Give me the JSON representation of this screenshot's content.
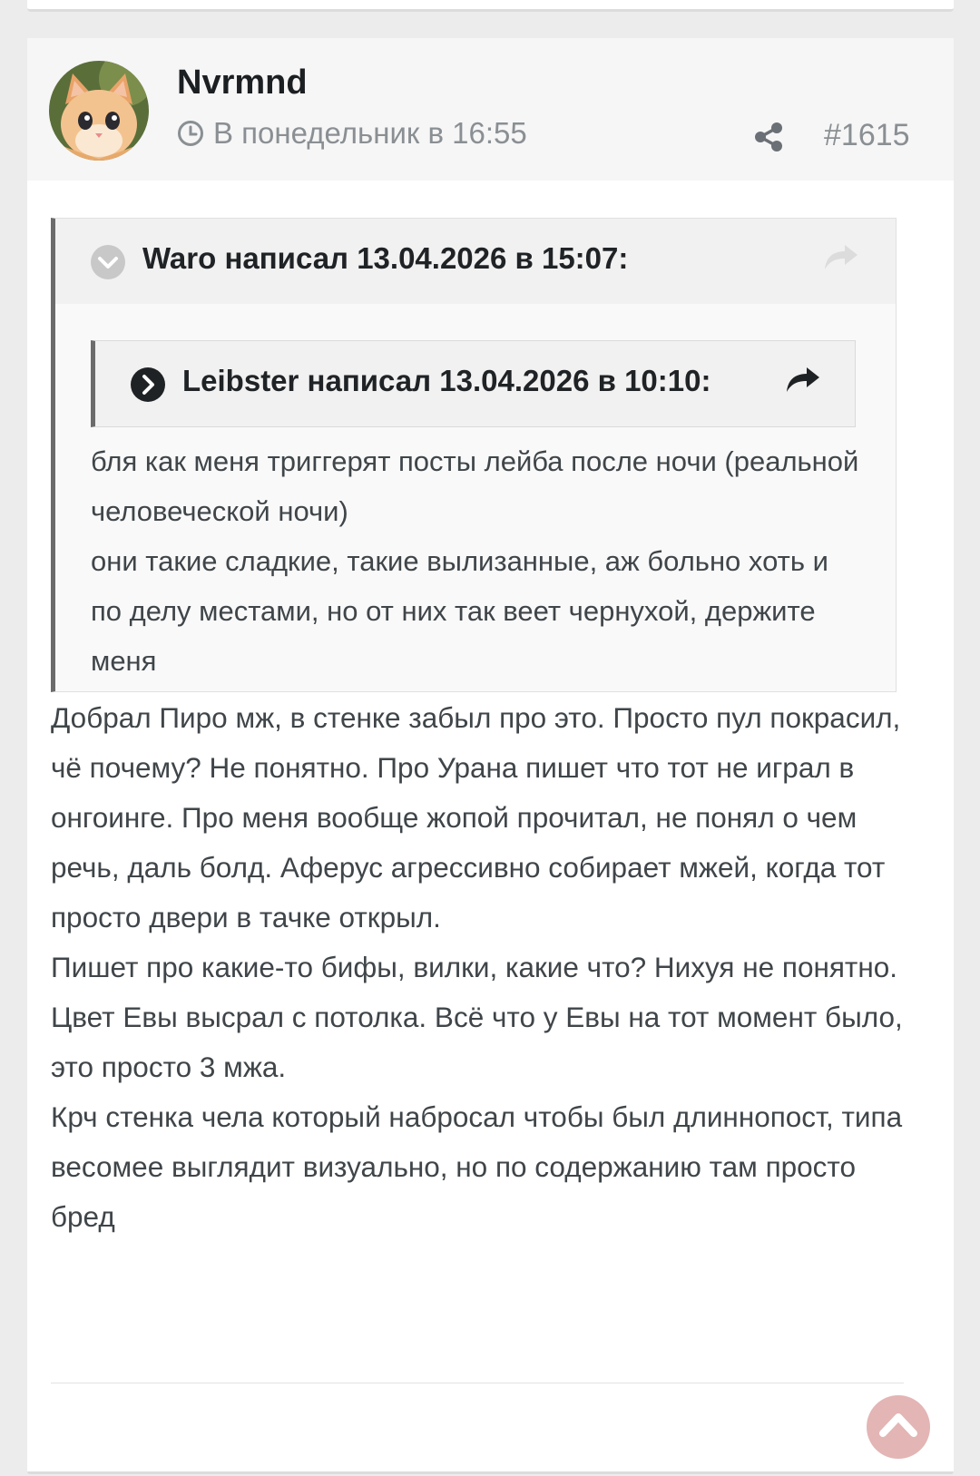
{
  "post": {
    "author": "Nvrmnd",
    "timestamp": "В понедельник в 16:55",
    "post_number": "#1615",
    "icons": {
      "time": "clock-icon",
      "share": "share-icon"
    }
  },
  "quote_outer": {
    "header": "Waro написал 13.04.2026 в 15:07:",
    "icons": {
      "toggle": "chevron-down-circle-icon",
      "goto": "reply-arrow-icon"
    }
  },
  "quote_inner": {
    "header": "Leibster написал 13.04.2026 в 10:10:",
    "icons": {
      "toggle": "chevron-right-circle-icon",
      "goto": "reply-arrow-icon"
    }
  },
  "quote_text": [
    "бля как меня триггерят посты лейба после ночи (реальной человеческой ночи)",
    "они такие сладкие, такие вылизанные, аж больно хоть и по делу местами, но от них так веет чернухой, держите меня"
  ],
  "body_paragraphs": [
    "Добрал Пиро мж, в стенке забыл про это. Просто пул покрасил, чё почему? Не понятно. Про Урана пишет что тот не играл в онгоинге. Про меня вообще жопой прочитал, не понял о чем речь, даль болд. Аферус агрессивно собирает мжей, когда тот просто двери в тачке открыл.",
    "Пишет про какие-то бифы, вилки, какие что? Нихуя не понятно.",
    "Цвет Евы высрал с потолка. Всё что у Евы на тот момент было, это просто 3 мжа.",
    "Крч стенка чела который набросал чтобы был длиннопост, типа весомее выглядит визуально, но по содержанию там просто бред"
  ],
  "scroll_top": {
    "icon": "chevron-up-icon"
  },
  "colors": {
    "page_bg": "#ececec",
    "card_bg": "#ffffff",
    "header_bg": "#f6f6f6",
    "quote_border": "#6b6b6b",
    "text": "#3f4549",
    "muted": "#8a8f93",
    "scroll_button": "#dea8a8"
  }
}
